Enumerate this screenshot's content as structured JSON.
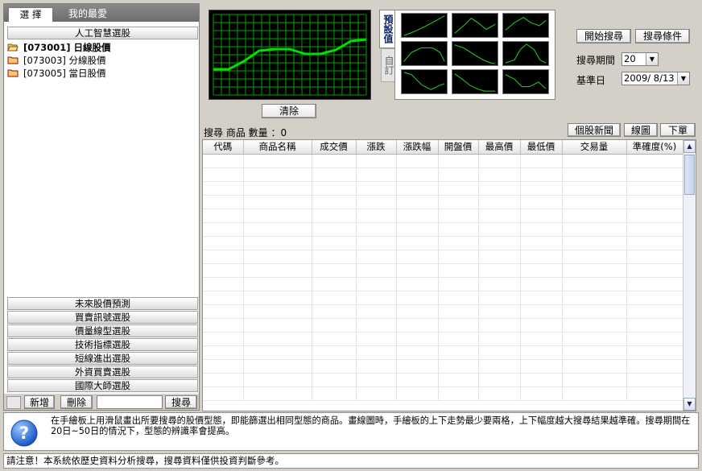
{
  "tabs": [
    {
      "label": "選 擇",
      "active": true
    },
    {
      "label": "我的最愛",
      "active": false
    }
  ],
  "sidebar": {
    "title": "人工智慧選股",
    "tree": [
      {
        "label": "[073001] 日線股價",
        "selected": true
      },
      {
        "label": "[073003] 分線股價",
        "selected": false
      },
      {
        "label": "[073005] 當日股價",
        "selected": false
      }
    ],
    "sections": [
      "未來股價預測",
      "買賣訊號選股",
      "價量線型選股",
      "技術指標選股",
      "短線進出選股",
      "外資買賣選股",
      "國際大師選股"
    ],
    "bottom": {
      "add_label": "新增",
      "delete_label": "刪除",
      "search_label": "搜尋",
      "search_value": ""
    }
  },
  "pattern": {
    "clear_label": "清除",
    "vtabs": [
      "預設值",
      "自訂"
    ],
    "sketch": [
      [
        0.0,
        0.32
      ],
      [
        0.1,
        0.32
      ],
      [
        0.2,
        0.42
      ],
      [
        0.3,
        0.55
      ],
      [
        0.4,
        0.57
      ],
      [
        0.5,
        0.57
      ],
      [
        0.6,
        0.51
      ],
      [
        0.7,
        0.51
      ],
      [
        0.8,
        0.56
      ],
      [
        0.9,
        0.67
      ],
      [
        1.0,
        0.69
      ]
    ]
  },
  "controls": {
    "start_label": "開始搜尋",
    "criteria_label": "搜尋條件",
    "period_label": "搜尋期間",
    "period_value": "20",
    "base_date_label": "基準日",
    "base_date_value": "2009/ 8/13"
  },
  "results": {
    "count_label": "搜尋 商品 數量 ：0",
    "news_label": "個股新聞",
    "chart_label": "線圖",
    "order_label": "下單",
    "columns": [
      "代碼",
      "商品名稱",
      "成交價",
      "漲跌",
      "漲跌幅",
      "開盤價",
      "最高價",
      "最低價",
      "交易量",
      "準確度(%)"
    ]
  },
  "help": {
    "text": "在手繪板上用滑鼠畫出所要搜尋的股價型態，即能篩選出相同型態的商品。畫線圖時，手繪板的上下走勢最少要兩格，上下幅度越大搜尋結果越準確。搜尋期間在20日~50日的情況下，型態的辨識率會提高。"
  },
  "status": {
    "text": "請注意！本系統依歷史資料分析搜尋，搜尋資料僅供投資判斷參考。"
  },
  "colors": {
    "accent": "#0a246a",
    "grid_green": "#00a000",
    "line_green": "#00e000"
  }
}
